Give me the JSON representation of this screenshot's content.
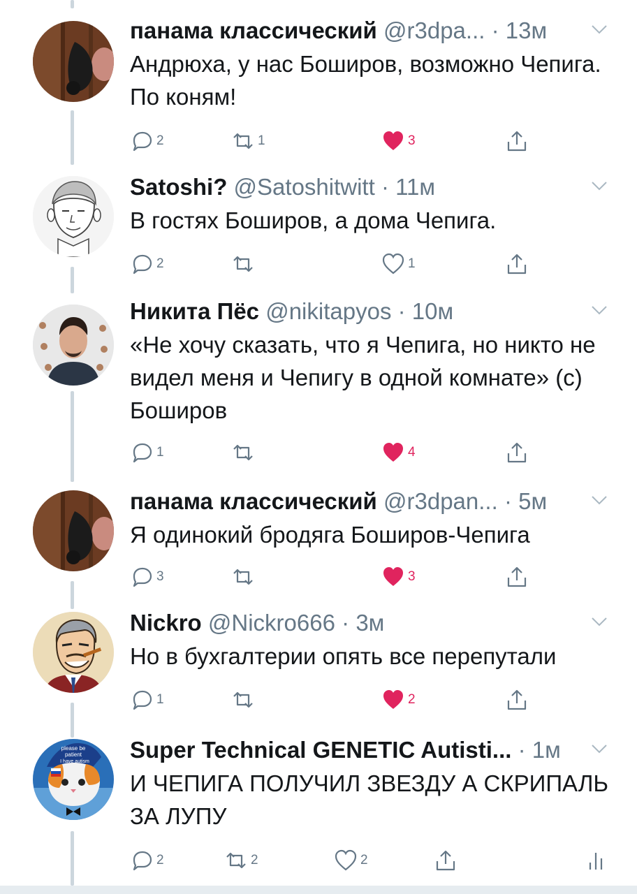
{
  "tweets": [
    {
      "name": "панама классический",
      "handle": "@r3dpa...",
      "time": "13м",
      "text": "Андрюха, у нас Боширов, возможно Чепига. По коням!",
      "replies": "2",
      "retweets": "1",
      "likes": "3",
      "liked": true
    },
    {
      "name": "Satoshi?",
      "handle": "@Satoshitwitt",
      "time": "11м",
      "text": "В гостях Боширов, а дома Чепига.",
      "replies": "2",
      "retweets": "",
      "likes": "1",
      "liked": false
    },
    {
      "name": "Никита Пёс",
      "handle": "@nikitapyos",
      "time": "10м",
      "text": "«Не хочу сказать, что я Чепига, но никто не видел меня и Чепигу в одной комнате» (с) Боширов",
      "replies": "1",
      "retweets": "",
      "likes": "4",
      "liked": true
    },
    {
      "name": "панама классический",
      "handle": "@r3dpan...",
      "time": "5м",
      "text": "Я одинокий бродяга Боширов-Чепига",
      "replies": "3",
      "retweets": "",
      "likes": "3",
      "liked": true
    },
    {
      "name": "Nickro",
      "handle": "@Nickro666",
      "time": "3м",
      "text": "Но в бухгалтерии опять все перепутали",
      "replies": "1",
      "retweets": "",
      "likes": "2",
      "liked": true
    },
    {
      "name": "Super Technical GENETIC Autisti...",
      "handle": "",
      "time": "1м",
      "text": "И ЧЕПИГА ПОЛУЧИЛ ЗВЕЗДУ А СКРИПАЛЬ ЗА ЛУПУ",
      "replies": "2",
      "retweets": "2",
      "likes": "2",
      "liked": false,
      "avatar_caption": [
        "please be",
        "patient",
        "I have autism"
      ]
    }
  ],
  "separator": "·",
  "colors": {
    "text": "#14171a",
    "secondary": "#657786",
    "like_active": "#e0245e",
    "thread_line": "#ccd6dd"
  },
  "icons": {
    "reply": "reply-icon",
    "retweet": "retweet-icon",
    "like": "heart-icon",
    "share": "share-icon",
    "analytics": "analytics-icon",
    "caret": "chevron-down-icon"
  }
}
